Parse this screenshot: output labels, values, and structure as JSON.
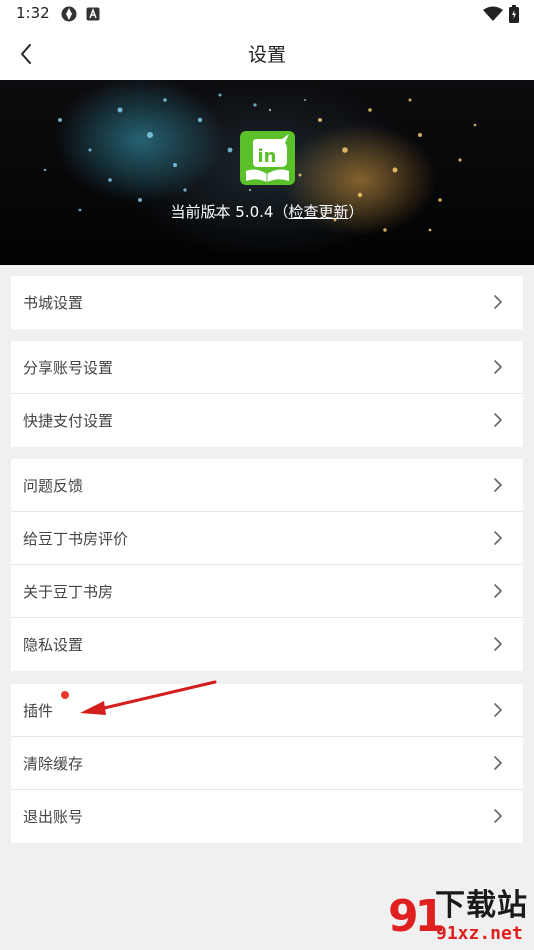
{
  "status_bar": {
    "time": "1:32"
  },
  "header": {
    "title": "设置"
  },
  "banner": {
    "version_text": "当前版本 5.0.4（",
    "check_update": "检查更新",
    "close_paren": "）"
  },
  "sections": [
    {
      "items": [
        {
          "label": "书城设置"
        }
      ]
    },
    {
      "items": [
        {
          "label": "分享账号设置"
        },
        {
          "label": "快捷支付设置"
        }
      ]
    },
    {
      "items": [
        {
          "label": "问题反馈"
        },
        {
          "label": "给豆丁书房评价"
        },
        {
          "label": "关于豆丁书房"
        },
        {
          "label": "隐私设置"
        }
      ]
    },
    {
      "items": [
        {
          "label": "插件",
          "badge": "red-dot"
        },
        {
          "label": "清除缓存"
        },
        {
          "label": "退出账号"
        }
      ]
    }
  ],
  "watermark": {
    "brand_num": "91",
    "brand_text": "下载站",
    "url": "91xz.net"
  },
  "colors": {
    "logo_green": "#5cc02b",
    "badge_red": "#e83a2c",
    "watermark_red": "#e02020",
    "background": "#f0f0f0"
  }
}
